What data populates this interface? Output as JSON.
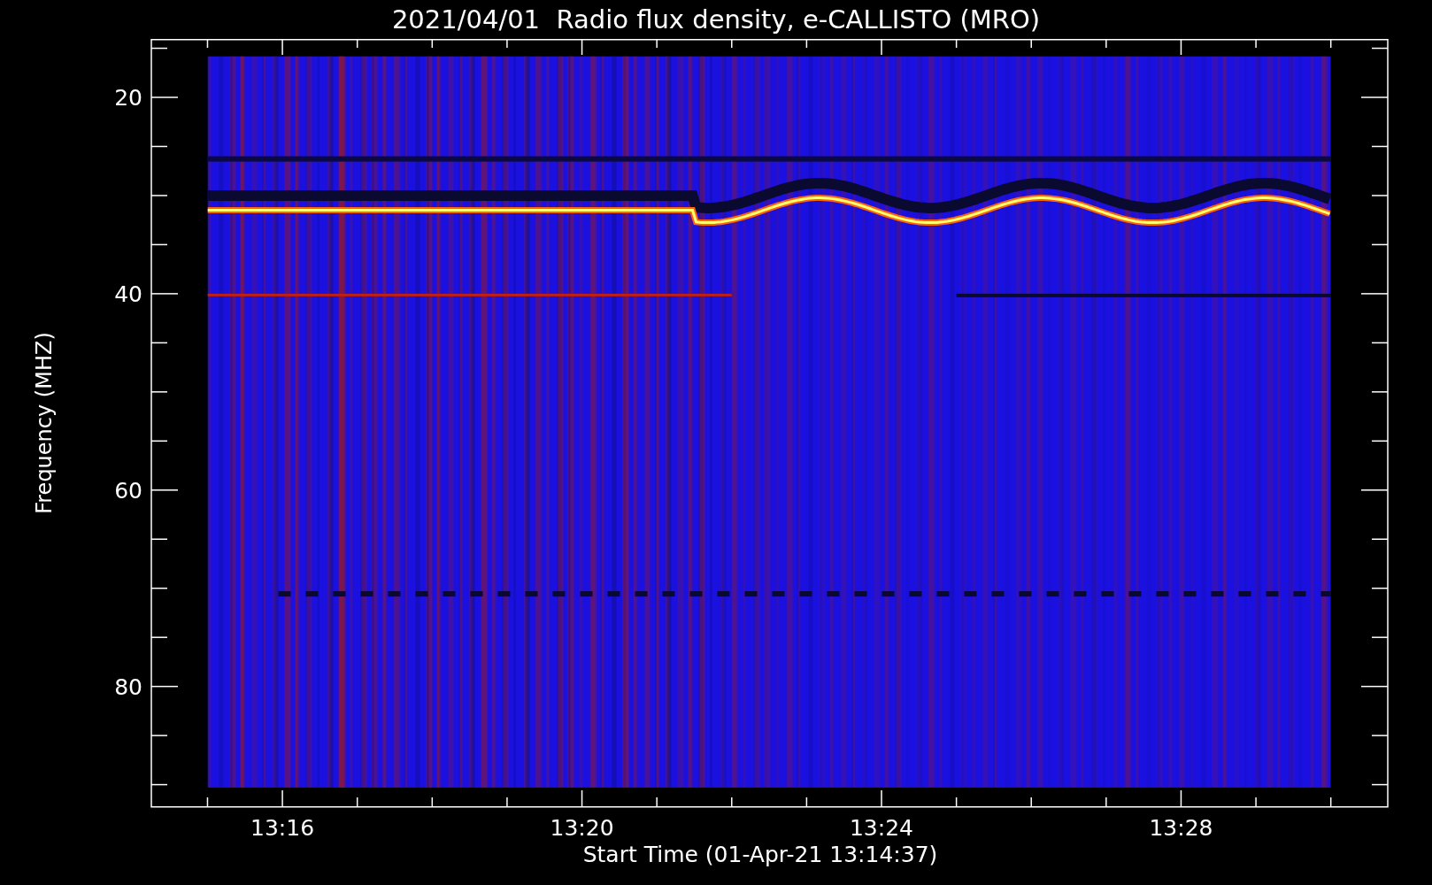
{
  "plot": {
    "title": "2021/04/01  Radio flux density, e-CALLISTO (MRO)",
    "xlabel": "Start Time (01-Apr-21 13:14:37)",
    "ylabel": "Frequency (MHZ)",
    "xticks": [
      "13:16",
      "13:20",
      "13:24",
      "13:28"
    ],
    "yticks": [
      "20",
      "40",
      "60",
      "80"
    ]
  }
}
